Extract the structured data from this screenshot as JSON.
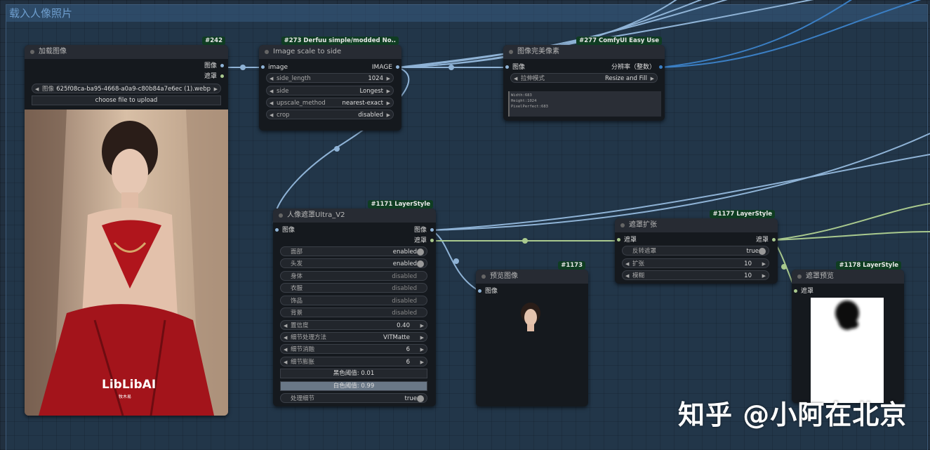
{
  "group": {
    "title": "载入人像照片"
  },
  "watermark": "知乎 @小阿在北京",
  "nodes": {
    "load_image": {
      "badge": "#242",
      "title": "加载图像",
      "outputs": [
        "图像",
        "遮罩"
      ],
      "image_widget_label": "图像",
      "image_widget_value": "625f08ca-ba95-4668-a0a9-c80b84a7e6ec (1).webp",
      "upload_button": "choose file to upload",
      "logo_text": "LibLibAI",
      "logo_sub": "牧木易"
    },
    "image_scale": {
      "badge": "#273 Derfuu simple/modded No..",
      "title": "Image scale to side",
      "input": "image",
      "output": "IMAGE",
      "widgets": [
        {
          "label": "side_length",
          "value": "1024"
        },
        {
          "label": "side",
          "value": "Longest"
        },
        {
          "label": "upscale_method",
          "value": "nearest-exact"
        },
        {
          "label": "crop",
          "value": "disabled"
        }
      ]
    },
    "pixel_perfect": {
      "badge": "#277 ComfyUI Easy Use",
      "title": "图像完美像素",
      "input": "图像",
      "output": "分辨率（整数）",
      "widget": {
        "label": "拉伸模式",
        "value": "Resize and Fill"
      },
      "info_lines": [
        "Width:683",
        "Height:1024",
        "PixelPerfect:683"
      ]
    },
    "person_mask": {
      "badge": "#1171 LayerStyle",
      "title": "人像遮罩Ultra_V2",
      "input": "图像",
      "outputs": [
        "图像",
        "遮罩"
      ],
      "toggles": [
        {
          "label": "面部",
          "value": "enabled",
          "on": true
        },
        {
          "label": "头发",
          "value": "enabled",
          "on": true
        },
        {
          "label": "身体",
          "value": "disabled",
          "on": false
        },
        {
          "label": "衣服",
          "value": "disabled",
          "on": false
        },
        {
          "label": "饰品",
          "value": "disabled",
          "on": false
        },
        {
          "label": "背景",
          "value": "disabled",
          "on": false
        }
      ],
      "widgets": [
        {
          "label": "置信度",
          "value": "0.40"
        },
        {
          "label": "细节处理方法",
          "value": "VITMatte"
        },
        {
          "label": "细节消融",
          "value": "6"
        },
        {
          "label": "细节膨胀",
          "value": "6"
        }
      ],
      "black_threshold": "黑色阈值: 0.01",
      "white_threshold": "白色阈值: 0.99",
      "process_detail": {
        "label": "处理细节",
        "value": "true"
      }
    },
    "preview": {
      "badge": "#1173",
      "title": "预览图像",
      "input": "图像"
    },
    "mask_grow": {
      "badge": "#1177 LayerStyle",
      "title": "遮罩扩张",
      "input": "遮罩",
      "output": "遮罩",
      "invert": {
        "label": "反转遮罩",
        "value": "true"
      },
      "widgets": [
        {
          "label": "扩张",
          "value": "10"
        },
        {
          "label": "模糊",
          "value": "10"
        }
      ]
    },
    "mask_preview": {
      "badge": "#1178 LayerStyle",
      "title": "遮罩预览",
      "input": "遮罩"
    }
  },
  "colors": {
    "image_wire": "#8fb3d6",
    "mask_wire": "#a9c98e",
    "badge": "#0f3d22",
    "group_title": "#6f9fcf"
  }
}
